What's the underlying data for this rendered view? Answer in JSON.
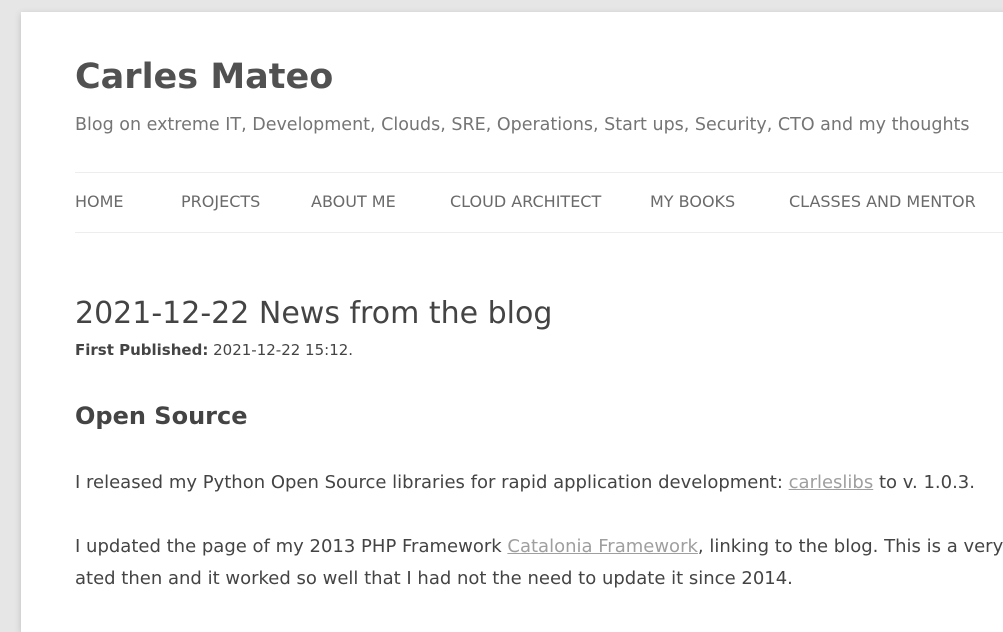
{
  "site": {
    "title": "Carles Mateo",
    "description": "Blog on extreme IT, Development, Clouds, SRE, Operations, Start ups, Security, CTO and my thoughts"
  },
  "nav": {
    "items": [
      {
        "label": "HOME"
      },
      {
        "label": "PROJECTS"
      },
      {
        "label": "ABOUT ME"
      },
      {
        "label": "CLOUD ARCHITECT"
      },
      {
        "label": "MY BOOKS"
      },
      {
        "label": "CLASSES AND MENTOR"
      }
    ]
  },
  "post": {
    "title": "2021-12-22 News from the blog",
    "published_label": "First Published:",
    "published_value": "2021-12-22 15:12.",
    "section_heading": "Open Source",
    "p1_before": "I released my Python Open Source libraries for rapid application development: ",
    "p1_link": "carleslibs",
    "p1_after": " to v. 1.0.3.",
    "p2_before": "I updated the page of my 2013 PHP Framework ",
    "p2_link": "Catalonia Framework",
    "p2_after": ", linking to the blog. This is a very nice",
    "p3_text": "ated then and it worked so well that I had not the need to update it since 2014."
  },
  "colors": {
    "background": "#e6e6e6",
    "page": "#ffffff",
    "link": "#9f9f9f",
    "nav_text": "#6a6a6a"
  }
}
